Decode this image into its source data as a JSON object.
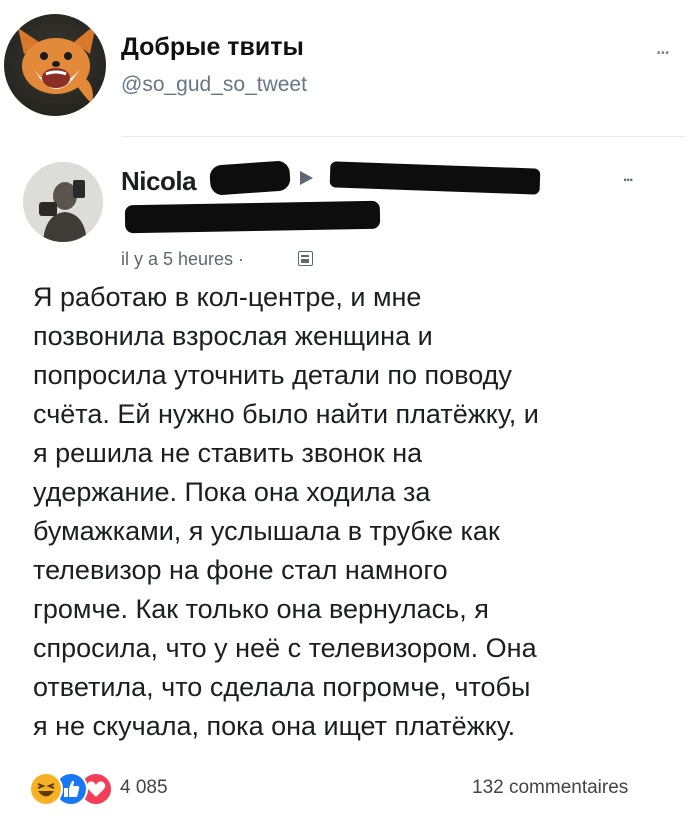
{
  "tweet": {
    "author_name": "Добрые твиты",
    "author_handle": "@so_gud_so_tweet",
    "more_label": "..."
  },
  "post": {
    "author_name": "Nicola",
    "timestamp": "il y a 5 heures ·",
    "more_label": "...",
    "text_lines": [
      "Я работаю в кол-центре, и мне",
      "позвонила взрослая женщина и",
      "попросила уточнить детали по поводу",
      "счёта. Ей нужно было найти платёжку, и",
      "я решила не ставить звонок на",
      "удержание. Пока она ходила за",
      "бумажками, я услышала в трубке как",
      "телевизор на фоне стал намного",
      "громче. Как только она вернулась, я",
      "спросила, что у неё с телевизором. Она",
      "ответила, что сделала погромче, чтобы",
      "я не скучала, пока она ищет платёжку."
    ],
    "reaction_count": "4 085",
    "comments_label": "132 commentaires",
    "reaction_icons": [
      "haha-reaction-icon",
      "like-reaction-icon",
      "love-reaction-icon"
    ]
  },
  "colors": {
    "facebook_blue": "#1877f2",
    "love_red": "#f33e58",
    "haha_yellow": "#f7b125",
    "handle_gray": "#657786"
  }
}
